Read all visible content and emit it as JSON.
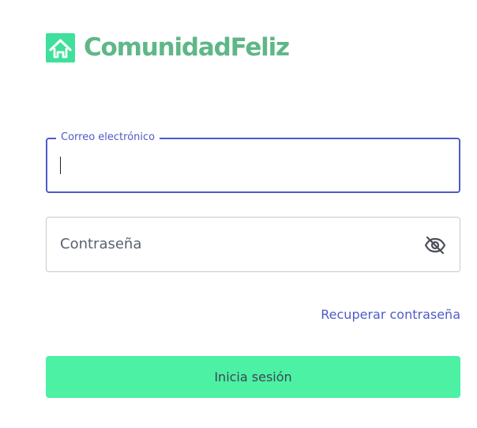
{
  "brand": {
    "name": "ComunidadFeliz",
    "color": "#5fb788"
  },
  "login_form": {
    "email": {
      "label": "Correo electrónico",
      "value": ""
    },
    "password": {
      "placeholder": "Contraseña",
      "toggle_icon": "eye-slash-icon"
    },
    "recover_link": "Recuperar contraseña",
    "submit_label": "Inicia sesión"
  },
  "colors": {
    "accent": "#4f5bc7",
    "button": "#4cf1a4"
  }
}
